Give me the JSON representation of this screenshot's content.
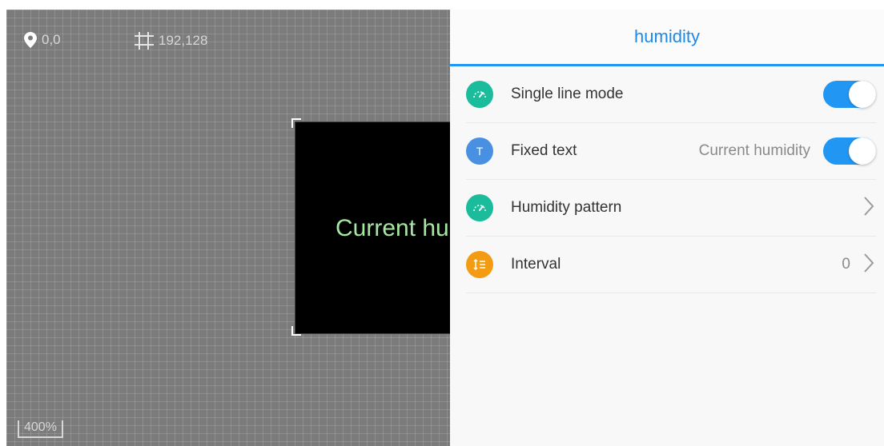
{
  "canvas": {
    "position": {
      "icon": "map-pin-icon",
      "value": "0,0"
    },
    "size": {
      "icon": "crop-icon",
      "value": "192,128"
    },
    "preview_text": "Current hu",
    "zoom": "400%"
  },
  "panel": {
    "title": "humidity",
    "accent": "#2196f3",
    "rows": [
      {
        "label": "Single line mode",
        "icon": "gauge-icon",
        "icon_color": "#1abc9c",
        "control": "toggle",
        "on": true
      },
      {
        "label": "Fixed text",
        "icon": "text-icon",
        "icon_glyph": "T",
        "icon_color": "#4a90e2",
        "value": "Current humidity",
        "control": "toggle",
        "on": true
      },
      {
        "label": "Humidity pattern",
        "icon": "gauge-icon",
        "icon_color": "#1abc9c",
        "control": "chevron"
      },
      {
        "label": "Interval",
        "icon": "interval-icon",
        "icon_color": "#f39c12",
        "value": "0",
        "control": "chevron"
      }
    ]
  }
}
